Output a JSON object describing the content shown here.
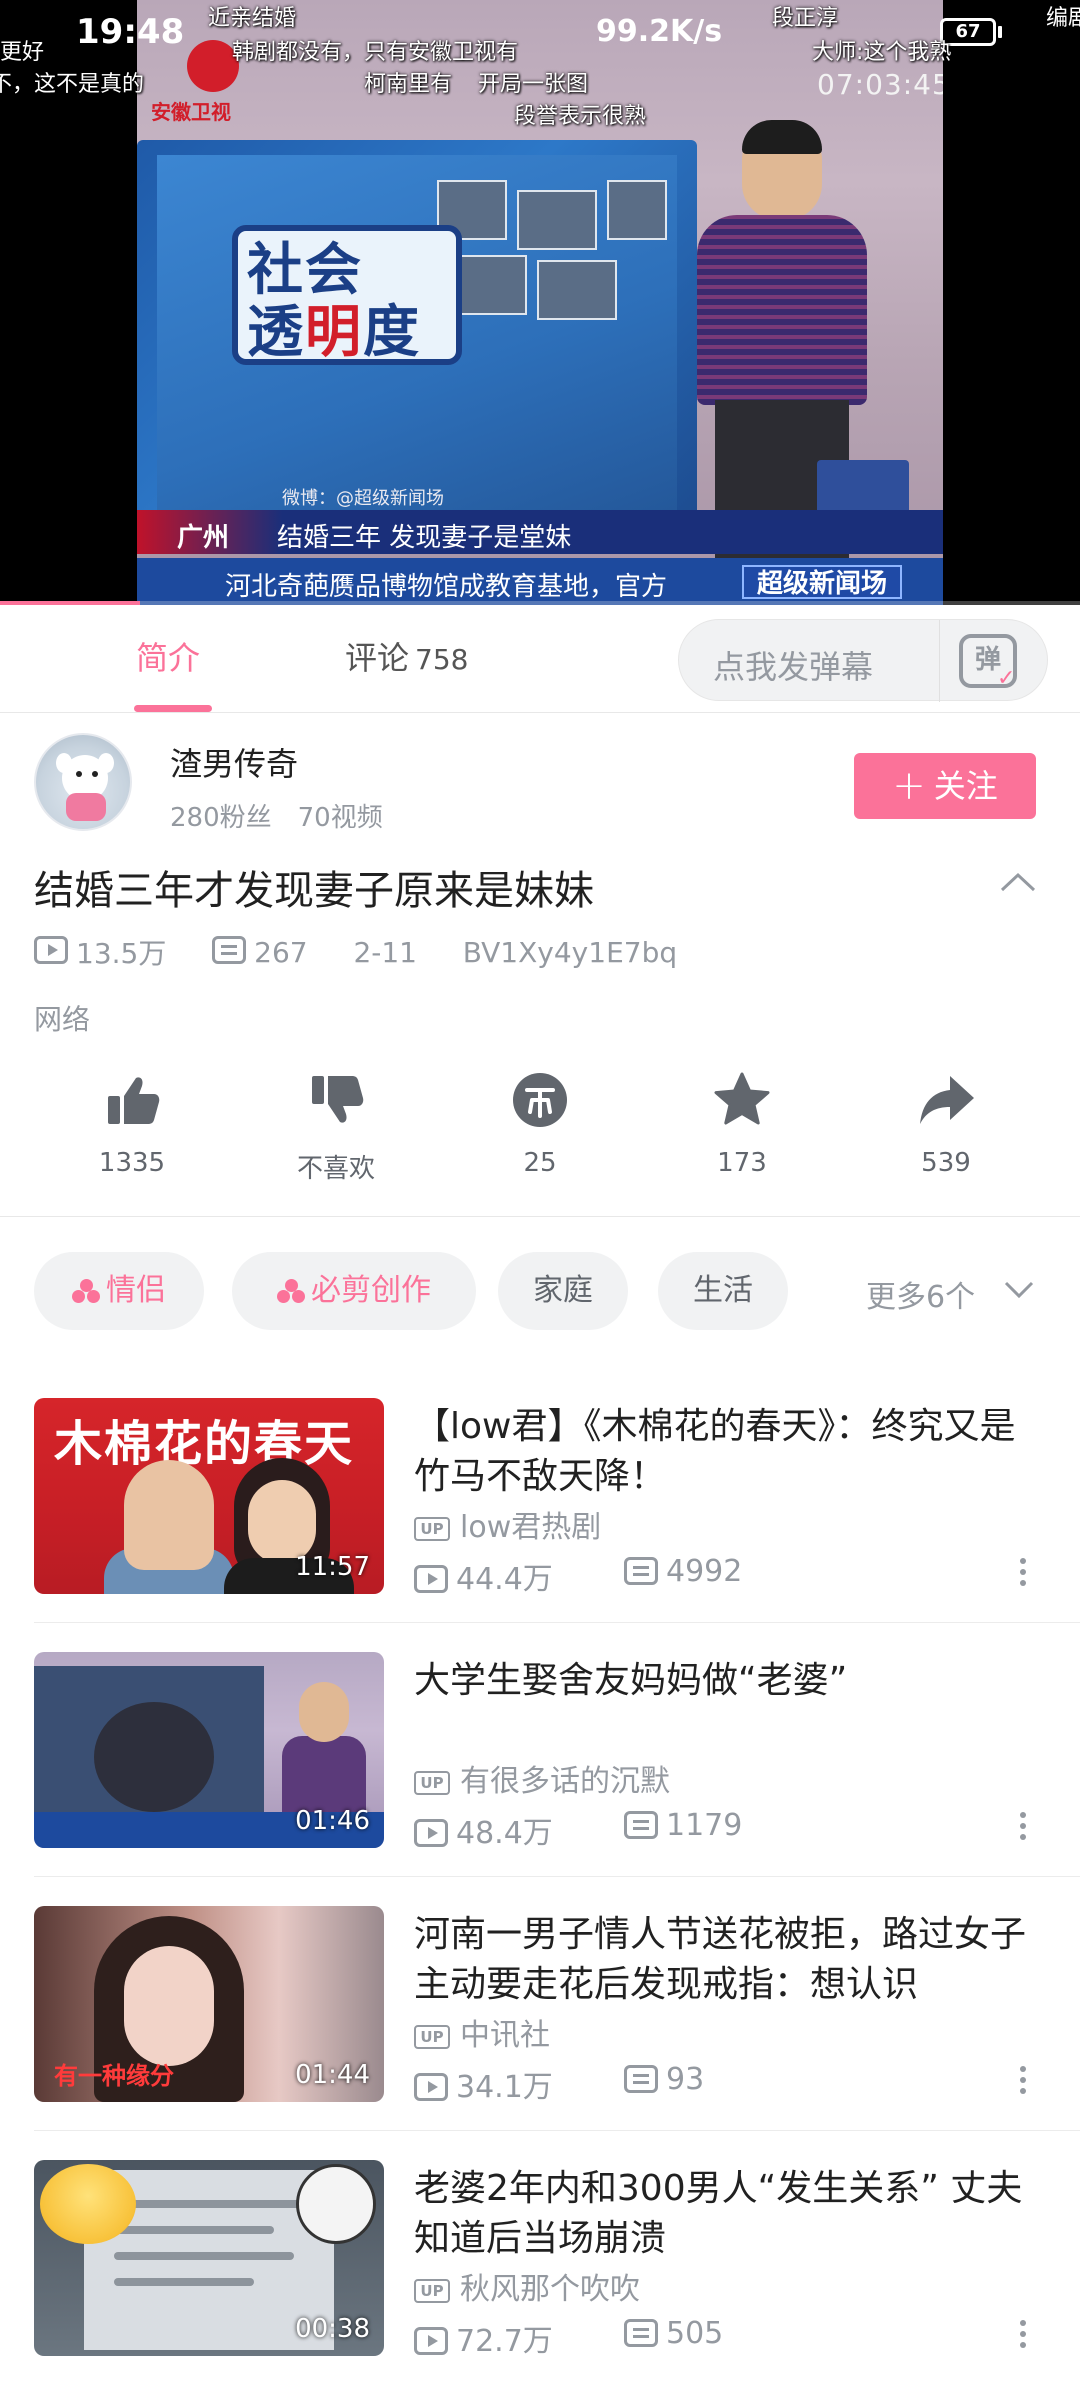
{
  "status_bar": {
    "time": "19:48",
    "net_speed": "99.2K/s",
    "battery": "67"
  },
  "player": {
    "progress_fraction": 0.13,
    "danmaku": [
      "近亲结婚",
      "韩剧都没有，只有安徽卫视有",
      "柯南里有",
      "开局一张图",
      "段誉表示很熟",
      "段正淳",
      "大师:这个我熟",
      "更好",
      "不，这不是真的",
      "编剧"
    ],
    "overlay": {
      "station": "安徽卫视",
      "show_logo_line1": "社会",
      "show_logo_line2a": "透",
      "show_logo_line2b": "明",
      "show_logo_line2c": "度",
      "clock": "07:03:45",
      "weibo": "微博：@超级新闻场",
      "city": "广州",
      "headline": "结婚三年 发现妻子是堂妹",
      "scroll": "河北奇葩赝品博物馆成教育基地，官方",
      "brand": "超级新闻场"
    }
  },
  "tabs": {
    "intro": "简介",
    "comments": "评论",
    "comments_count": "758",
    "danmaku_placeholder": "点我发弹幕",
    "danmaku_icon": "弹"
  },
  "uploader": {
    "name": "渣男传奇",
    "fans": "280粉丝",
    "videos": "70视频",
    "follow_label": "关注",
    "follow_plus": "+"
  },
  "video": {
    "title": "结婚三年才发现妻子原来是妹妹",
    "views": "13.5万",
    "danmaku_count": "267",
    "date": "2-11",
    "bvid": "BV1Xy4y1E7bq",
    "category": "网络"
  },
  "actions": {
    "like": "1335",
    "dislike": "不喜欢",
    "coin": "25",
    "favorite": "173",
    "share": "539"
  },
  "tags": {
    "items": [
      "情侣",
      "必剪创作",
      "家庭",
      "生活"
    ],
    "more": "更多6个"
  },
  "related": [
    {
      "title": "【low君】《木棉花的春天》：终究又是竹马不敌天降！",
      "thumb_text": "木棉花的春天",
      "duration": "11:57",
      "up": "low君热剧",
      "views": "44.4万",
      "danmaku": "4992"
    },
    {
      "title": "大学生娶舍友妈妈做“老婆”",
      "duration": "01:46",
      "up": "有很多话的沉默",
      "views": "48.4万",
      "danmaku": "1179"
    },
    {
      "title": "河南一男子情人节送花被拒，路过女子主动要走花后发现戒指：想认识",
      "thumb_text": "有一种缘分",
      "duration": "01:44",
      "up": "中讯社",
      "views": "34.1万",
      "danmaku": "93"
    },
    {
      "title": "老婆2年内和300男人“发生关系” 丈夫知道后当场崩溃",
      "duration": "00:38",
      "up": "秋风那个吹吹",
      "views": "72.7万",
      "danmaku": "505"
    }
  ],
  "up_badge": "UP",
  "colors": {
    "accent": "#fb7299",
    "muted": "#9499a0"
  }
}
